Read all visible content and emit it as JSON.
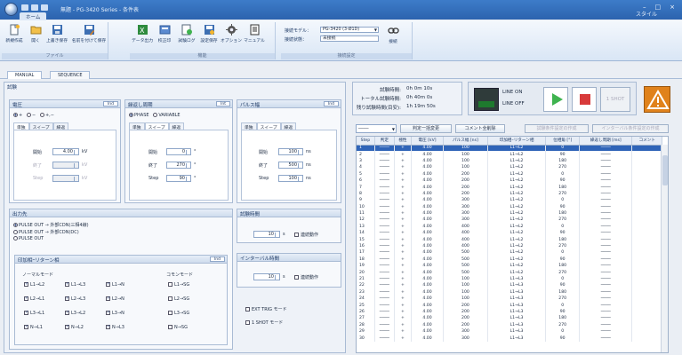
{
  "window": {
    "title": "無題 - PG-3420 Series - 条件表",
    "tab": "ホーム",
    "style_link": "スタイル",
    "controls": [
      "–",
      "□",
      "×"
    ]
  },
  "ribbon": {
    "buttons": [
      {
        "label": "新規作成",
        "icon": "new-file-icon"
      },
      {
        "label": "開く",
        "icon": "open-folder-icon"
      },
      {
        "label": "上書き保存",
        "icon": "save-icon"
      },
      {
        "label": "名前を付けて保存",
        "icon": "save-as-icon"
      },
      {
        "label": "データ出力",
        "icon": "data-export-icon"
      },
      {
        "label": "校正印",
        "icon": "calibrate-icon"
      },
      {
        "label": "試験ログ",
        "icon": "test-log-icon"
      },
      {
        "label": "設定保存",
        "icon": "settings-save-icon"
      },
      {
        "label": "オプション",
        "icon": "option-gear-icon"
      },
      {
        "label": "マニュアル",
        "icon": "manual-icon"
      }
    ],
    "groups": [
      "ファイル",
      "機能",
      "接続設定"
    ],
    "model_label": "接続モデル：",
    "model_value": "PG-3420 (3-Ø1D)",
    "status_label": "接続状態：",
    "status_value": "未接続",
    "connect_label": "接続"
  },
  "doc_tabs": [
    "MANUAL",
    "SEQUENCE"
  ],
  "test_section_label": "試験",
  "voltage": {
    "title": "電圧",
    "sel": "Ind",
    "modes": [
      "+",
      "−",
      "+,−"
    ],
    "subtabs": [
      "単独",
      "スイープ",
      "繰返"
    ],
    "rows": [
      {
        "label": "開始",
        "value": "4.00",
        "unit": "kV"
      },
      {
        "label": "終了",
        "value": "",
        "unit": "kV"
      },
      {
        "label": "Step",
        "value": "",
        "unit": "kV"
      }
    ]
  },
  "repeat": {
    "title": "繰返し周期",
    "sel": "Int",
    "modes": [
      "PHASE",
      "VARIABLE"
    ],
    "subtabs": [
      "単独",
      "スイープ",
      "繰返"
    ],
    "rows": [
      {
        "label": "開始",
        "value": "0",
        "unit": "°"
      },
      {
        "label": "終了",
        "value": "270",
        "unit": "°"
      },
      {
        "label": "Step",
        "value": "90",
        "unit": "°"
      }
    ]
  },
  "pulse": {
    "title": "パルス幅",
    "sel": "Ind",
    "subtabs": [
      "単独",
      "スイープ",
      "繰返"
    ],
    "rows": [
      {
        "label": "開始",
        "value": "100",
        "unit": "ns"
      },
      {
        "label": "終了",
        "value": "500",
        "unit": "ns"
      },
      {
        "label": "Step",
        "value": "100",
        "unit": "ns"
      }
    ]
  },
  "output": {
    "title": "出力先",
    "options": [
      "PULSE OUT → 外部CDN(三相4線)",
      "PULSE OUT → 外部CDN(DC)",
      "PULSE OUT"
    ]
  },
  "inject": {
    "title": "印加相ｰリターン相",
    "sel": "Ind",
    "normal_label": "ノーマルモード",
    "common_label": "コモンモード",
    "normal": [
      [
        "L1→L2",
        "L1→L3",
        "L1→N"
      ],
      [
        "L2→L1",
        "L2→L3",
        "L2→N"
      ],
      [
        "L3→L1",
        "L3→L2",
        "L3→N"
      ],
      [
        "N→L1",
        "N→L2",
        "N→L3"
      ]
    ],
    "common": [
      "L1→SG",
      "L2→SG",
      "L3→SG",
      "N→SG"
    ]
  },
  "test_time": {
    "title": "試験時間",
    "value": "10",
    "unit": "s",
    "cont": "連続動作"
  },
  "interval": {
    "title": "インターバル時間",
    "value": "10",
    "unit": "s",
    "cont": "連続動作"
  },
  "trig": {
    "ext": "EXT TRIG モード",
    "oneshot": "1 SHOT モード"
  },
  "timers": [
    {
      "label": "試験時間:",
      "value": "0h  0m  10s"
    },
    {
      "label": "トータル試験時間:",
      "value": "0h  40m  0s"
    },
    {
      "label": "残り試験時間(目安):",
      "value": "1h  19m  50s"
    }
  ],
  "lamps": {
    "line_on": "LINE ON",
    "line_off": "LINE OFF"
  },
  "controls": {
    "one_shot": "1 SHOT"
  },
  "list_toolbar": {
    "combo": "────",
    "batch_change": "判定一括変更",
    "comment_all": "コメント全削除",
    "btn3": "試験条件設定の作成",
    "btn4": "インターバル条件設定の作成"
  },
  "grid": {
    "headers": [
      "Step",
      "判定",
      "極性",
      "電圧 [kV]",
      "パルス幅 [ns]",
      "印加相ｰリターン相",
      "位相角 [°]",
      "繰返し周期 [ms]",
      "コメント"
    ],
    "rows": [
      [
        "1",
        "────",
        "+",
        "4.00",
        "100",
        "L1→L2",
        "0",
        "────",
        ""
      ],
      [
        "2",
        "────",
        "+",
        "4.00",
        "100",
        "L1→L2",
        "90",
        "────",
        ""
      ],
      [
        "3",
        "────",
        "+",
        "4.00",
        "100",
        "L1→L2",
        "180",
        "────",
        ""
      ],
      [
        "4",
        "────",
        "+",
        "4.00",
        "100",
        "L1→L2",
        "270",
        "────",
        ""
      ],
      [
        "5",
        "────",
        "+",
        "4.00",
        "200",
        "L1→L2",
        "0",
        "────",
        ""
      ],
      [
        "6",
        "────",
        "+",
        "4.00",
        "200",
        "L1→L2",
        "90",
        "────",
        ""
      ],
      [
        "7",
        "────",
        "+",
        "4.00",
        "200",
        "L1→L2",
        "180",
        "────",
        ""
      ],
      [
        "8",
        "────",
        "+",
        "4.00",
        "200",
        "L1→L2",
        "270",
        "────",
        ""
      ],
      [
        "9",
        "────",
        "+",
        "4.00",
        "300",
        "L1→L2",
        "0",
        "────",
        ""
      ],
      [
        "10",
        "────",
        "+",
        "4.00",
        "300",
        "L1→L2",
        "90",
        "────",
        ""
      ],
      [
        "11",
        "────",
        "+",
        "4.00",
        "300",
        "L1→L2",
        "180",
        "────",
        ""
      ],
      [
        "12",
        "────",
        "+",
        "4.00",
        "300",
        "L1→L2",
        "270",
        "────",
        ""
      ],
      [
        "13",
        "────",
        "+",
        "4.00",
        "400",
        "L1→L2",
        "0",
        "────",
        ""
      ],
      [
        "14",
        "────",
        "+",
        "4.00",
        "400",
        "L1→L2",
        "90",
        "────",
        ""
      ],
      [
        "15",
        "────",
        "+",
        "4.00",
        "400",
        "L1→L2",
        "180",
        "────",
        ""
      ],
      [
        "16",
        "────",
        "+",
        "4.00",
        "400",
        "L1→L2",
        "270",
        "────",
        ""
      ],
      [
        "17",
        "────",
        "+",
        "4.00",
        "500",
        "L1→L2",
        "0",
        "────",
        ""
      ],
      [
        "18",
        "────",
        "+",
        "4.00",
        "500",
        "L1→L2",
        "90",
        "────",
        ""
      ],
      [
        "19",
        "────",
        "+",
        "4.00",
        "500",
        "L1→L2",
        "180",
        "────",
        ""
      ],
      [
        "20",
        "────",
        "+",
        "4.00",
        "500",
        "L1→L2",
        "270",
        "────",
        ""
      ],
      [
        "21",
        "────",
        "+",
        "4.00",
        "100",
        "L1→L3",
        "0",
        "────",
        ""
      ],
      [
        "22",
        "────",
        "+",
        "4.00",
        "100",
        "L1→L3",
        "90",
        "────",
        ""
      ],
      [
        "23",
        "────",
        "+",
        "4.00",
        "100",
        "L1→L3",
        "180",
        "────",
        ""
      ],
      [
        "24",
        "────",
        "+",
        "4.00",
        "100",
        "L1→L3",
        "270",
        "────",
        ""
      ],
      [
        "25",
        "────",
        "+",
        "4.00",
        "200",
        "L1→L3",
        "0",
        "────",
        ""
      ],
      [
        "26",
        "────",
        "+",
        "4.00",
        "200",
        "L1→L3",
        "90",
        "────",
        ""
      ],
      [
        "27",
        "────",
        "+",
        "4.00",
        "200",
        "L1→L3",
        "180",
        "────",
        ""
      ],
      [
        "28",
        "────",
        "+",
        "4.00",
        "200",
        "L1→L3",
        "270",
        "────",
        ""
      ],
      [
        "29",
        "────",
        "+",
        "4.00",
        "300",
        "L1→L3",
        "0",
        "────",
        ""
      ],
      [
        "30",
        "────",
        "+",
        "4.00",
        "300",
        "L1→L3",
        "90",
        "────",
        ""
      ]
    ]
  },
  "colors": {
    "title_blue": "#2c63ae",
    "ribbon_bg": "#dbe7f6",
    "select_blue": "#2f64b8",
    "play_green": "#3fb34f",
    "stop_red": "#d83a3a",
    "warn_orange": "#e0821c",
    "lamp_green": "#1e7a2e"
  }
}
